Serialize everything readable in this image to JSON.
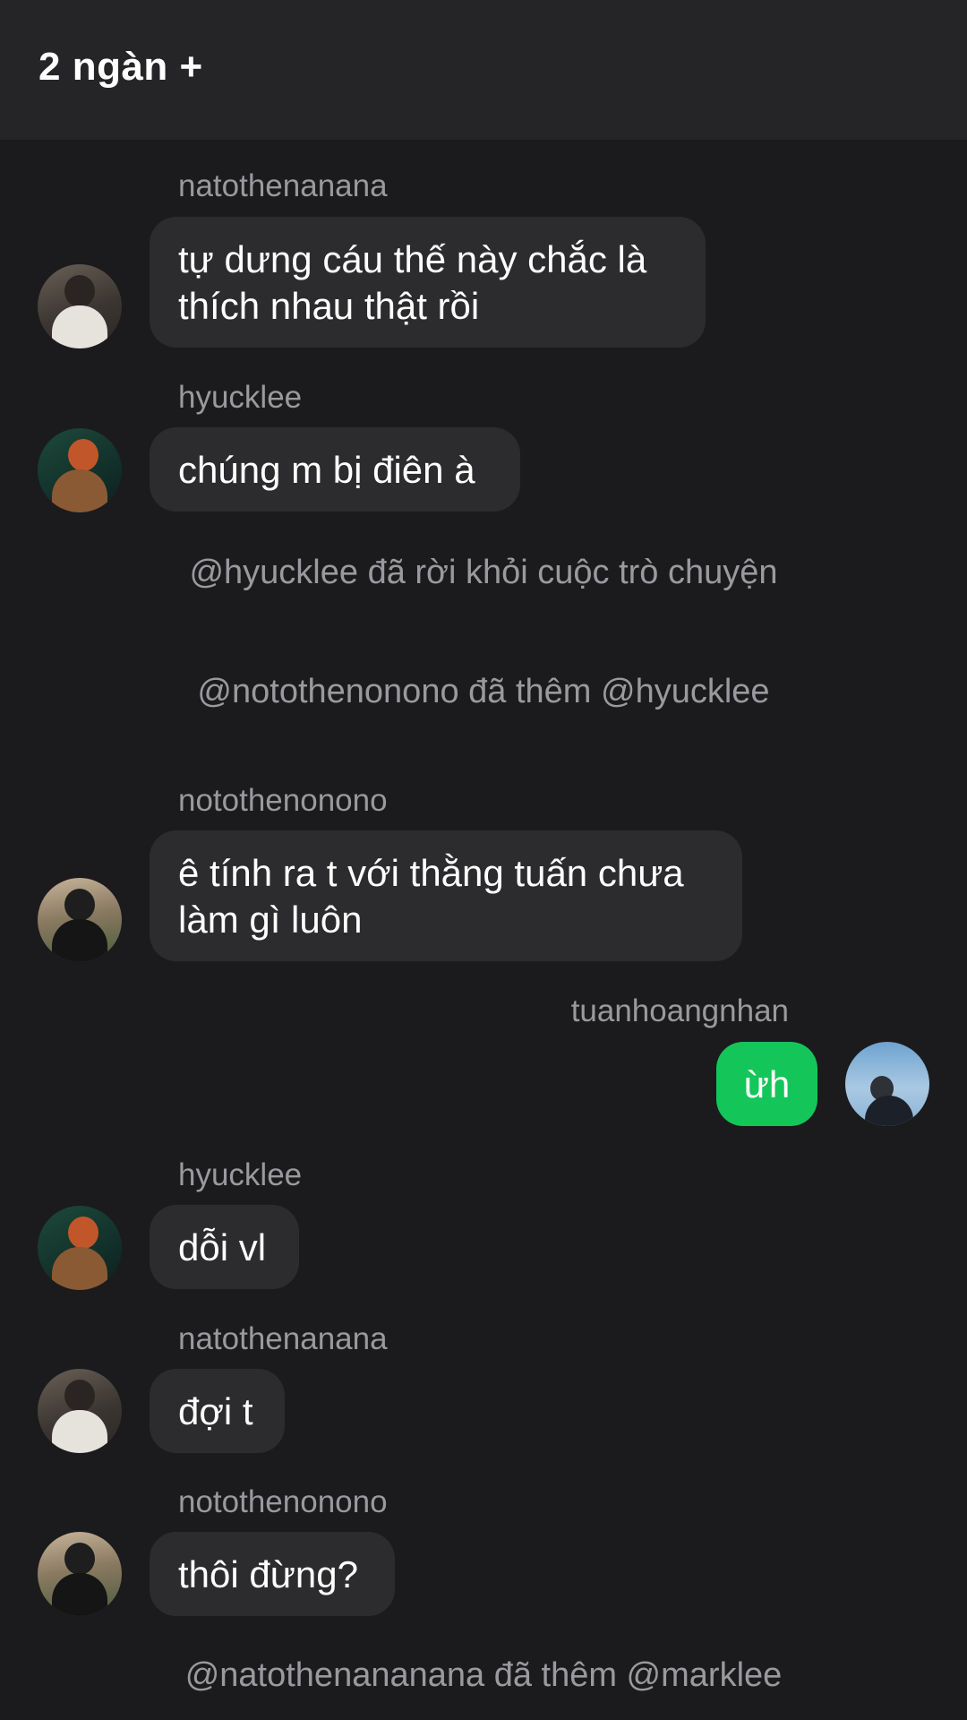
{
  "header": {
    "title": "2 ngàn +"
  },
  "messages": [
    {
      "sender": "natothenanana",
      "lines": [
        "tự dưng cáu thế này chắc là",
        "thích nhau thật rồi"
      ]
    },
    {
      "sender": "hyucklee",
      "lines": [
        "chúng m bị điên à"
      ]
    },
    {
      "sender": "notothenonono",
      "lines": [
        "ê tính ra t với thằng tuấn chưa",
        "làm gì luôn"
      ]
    },
    {
      "sender": "tuanhoangnhan",
      "lines": [
        "ừh"
      ]
    },
    {
      "sender": "hyucklee",
      "lines": [
        "dỗi vl"
      ]
    },
    {
      "sender": "natothenanana",
      "lines": [
        "đợi t"
      ]
    },
    {
      "sender": "notothenonono",
      "lines": [
        "thôi đừng?"
      ]
    }
  ],
  "system": [
    "@hyucklee đã rời khỏi cuộc trò chuyện",
    "@notothenonono đã thêm @hyucklee",
    "@natothenananana đã thêm @marklee"
  ],
  "colors": {
    "background": "#1b1b1d",
    "header": "#252527",
    "incoming_bubble": "#2c2c2e",
    "outgoing_bubble": "#14c659",
    "secondary_text": "#9a9a9e"
  }
}
